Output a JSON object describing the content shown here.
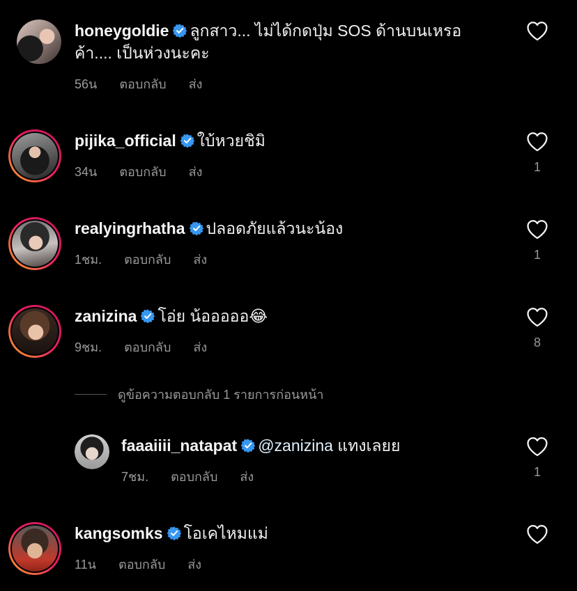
{
  "comments": [
    {
      "user": "honeygoldie",
      "text": "ลูกสาว... ไม่ได้กดปุ่ม SOS ด้านบนเหรอ",
      "text2": "ค้า.... เป็นห่วงนะคะ",
      "time": "56น",
      "reply": "ตอบกลับ",
      "send": "ส่ง",
      "likes": ""
    },
    {
      "user": "pijika_official",
      "text": "ใบ้หวยชิมิ",
      "time": "34น",
      "reply": "ตอบกลับ",
      "send": "ส่ง",
      "likes": "1"
    },
    {
      "user": "realyingrhatha",
      "text": "ปลอดภัยแล้วนะน้อง",
      "time": "1ชม.",
      "reply": "ตอบกลับ",
      "send": "ส่ง",
      "likes": "1"
    },
    {
      "user": "zanizina",
      "text": "โอ่ย น้อออออ😂",
      "time": "9ชม.",
      "reply": "ตอบกลับ",
      "send": "ส่ง",
      "likes": "8"
    },
    {
      "user": "faaaiiii_natapat",
      "mention": "@zanizina",
      "text": " แทงเลยย",
      "time": "7ชม.",
      "reply": "ตอบกลับ",
      "send": "ส่ง",
      "likes": "1"
    },
    {
      "user": "kangsomks",
      "text": "โอเคไหมแม่",
      "time": "11น",
      "reply": "ตอบกลับ",
      "send": "ส่ง",
      "likes": ""
    }
  ],
  "view_replies": "ดูข้อความตอบกลับ 1 รายการก่อนหน้า",
  "colors": {
    "background": "#000000",
    "verified": "#3897f0",
    "muted": "#9a9a9a",
    "mention": "#e0f1ff"
  }
}
